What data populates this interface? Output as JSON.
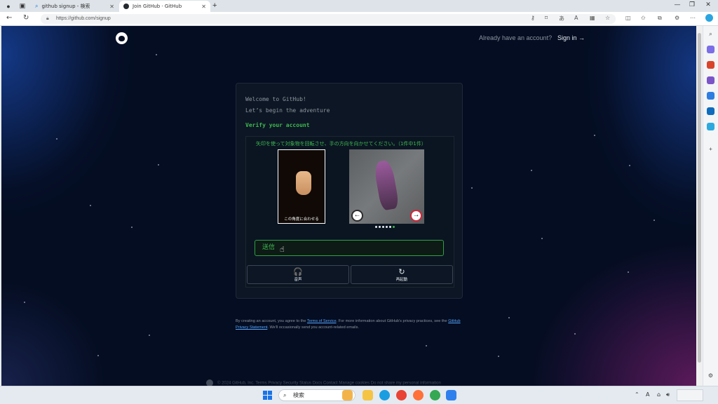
{
  "browser": {
    "tabs": [
      {
        "title": "github signup - 検索",
        "active": false
      },
      {
        "title": "Join GitHub · GitHub",
        "active": true
      }
    ],
    "url": "https://github.com/signup"
  },
  "header": {
    "already_text": "Already have an account?",
    "signin_label": "Sign in →"
  },
  "card": {
    "welcome_line1": "Welcome to GitHub!",
    "welcome_line2": "Let’s begin the adventure",
    "verify_heading": "Verify your account"
  },
  "captcha": {
    "instruction": "矢印を使って対象物を回転させ、手の方向を向かせてください。（1件中1件）",
    "reference_caption": "この角度に合わせる",
    "arrow_left": "←",
    "arrow_right": "→",
    "dots_total": 6,
    "dot_active_index": 5,
    "submit_label": "送信",
    "audio_icon": "🎧",
    "audio_label": "音声",
    "restart_icon": "↻",
    "restart_label": "再起動"
  },
  "terms": {
    "prefix": "By creating an account, you agree to the ",
    "tos_link": "Terms of Service",
    "middle": ". For more information about GitHub's privacy practices, see the ",
    "privacy_link": "GitHub Privacy Statement",
    "suffix": ". We'll occasionally send you account-related emails."
  },
  "footer": {
    "text": "© 2024 GitHub, Inc.   Terms   Privacy   Security   Status   Docs   Contact   Manage cookies   Do not share my personal information"
  },
  "taskbar": {
    "search_placeholder": "検索"
  },
  "colors": {
    "accent_green": "#3fb950",
    "link_blue": "#58a6ff",
    "page_bg": "#040d21"
  }
}
